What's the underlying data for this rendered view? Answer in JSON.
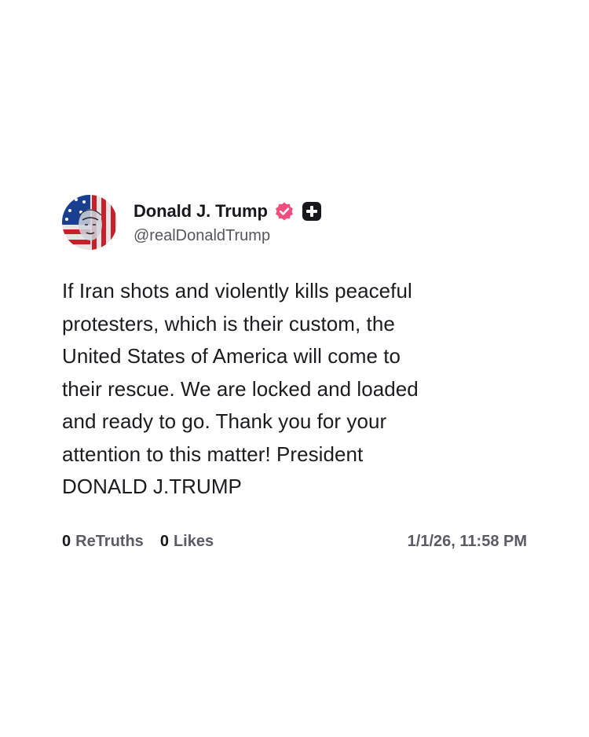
{
  "post": {
    "author": {
      "display_name": "Donald J. Trump",
      "handle": "@realDonaldTrump",
      "verified": true
    },
    "text": "If Iran shots and violently kills peaceful\nprotesters, which is their custom, the\nUnited States of America will come to\ntheir rescue. We are locked and loaded\nand ready to go. Thank you for your\nattention to this matter! President\nDONALD J.TRUMP",
    "stats": {
      "retruths_count": "0",
      "retruths_label": "ReTruths",
      "likes_count": "0",
      "likes_label": "Likes"
    },
    "timestamp": "1/1/26, 11:58 PM"
  },
  "colors": {
    "verified_badge": "#ee4f7f",
    "plus_badge": "#17171c",
    "muted_text": "#5b5b66",
    "primary_text": "#17171c",
    "background": "#ffffff"
  },
  "icons": {
    "avatar": "avatar",
    "verified": "verified-icon",
    "plus": "plus-badge-icon"
  }
}
